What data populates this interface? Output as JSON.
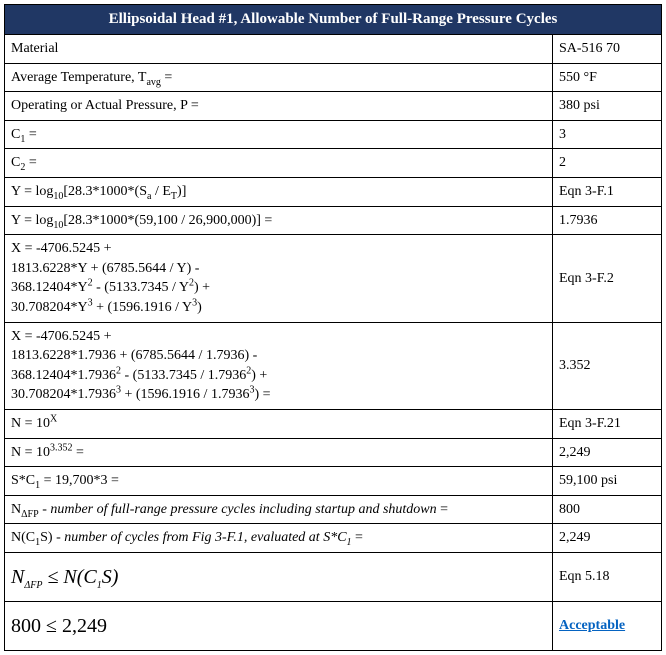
{
  "title": "Ellipsoidal Head #1, Allowable Number of Full-Range Pressure Cycles",
  "rows": {
    "material": {
      "label": "Material",
      "value": "SA-516 70"
    },
    "tavg": {
      "label_pre": "Average Temperature, T",
      "label_sub": "avg",
      "label_post": " =",
      "value": "550 °F"
    },
    "pressure": {
      "label": "Operating or Actual Pressure, P =",
      "value": "380 psi"
    },
    "c1": {
      "label_pre": "C",
      "label_sub": "1",
      "label_post": " =",
      "value": "3"
    },
    "c2": {
      "label_pre": "C",
      "label_sub": "2",
      "label_post": " =",
      "value": "2"
    },
    "ydef": {
      "label_pre": "Y = log",
      "label_sub": "10",
      "label_mid": "[28.3*1000*(S",
      "label_sub2": "a",
      "label_mid2": " / E",
      "label_sub3": "T",
      "label_post": ")]",
      "value": "Eqn 3-F.1"
    },
    "yval": {
      "label_pre": "Y = log",
      "label_sub": "10",
      "label_post": "[28.3*1000*(59,100 / 26,900,000)] =",
      "value": "1.7936"
    },
    "xdef": {
      "l1": "X = -4706.5245 +",
      "l2a": "1813.6228*Y + (6785.5644 / Y) -",
      "l3a": "368.12404*Y",
      "l3b": " - (5133.7345 / Y",
      "l3c": ") +",
      "l4a": "30.708204*Y",
      "l4b": " + (1596.1916 / Y",
      "l4c": ")",
      "value": "Eqn 3-F.2"
    },
    "xval": {
      "l1": "X = -4706.5245 +",
      "l2": "1813.6228*1.7936 + (6785.5644 / 1.7936) -",
      "l3a": "368.12404*1.7936",
      "l3b": " - (5133.7345 / 1.7936",
      "l3c": ") +",
      "l4a": "30.708204*1.7936",
      "l4b": " + (1596.1916 / 1.7936",
      "l4c": ") =",
      "value": "3.352"
    },
    "ndef": {
      "label_pre": "N = 10",
      "label_sup": "X",
      "value": "Eqn 3-F.21"
    },
    "nval": {
      "label_pre": "N = 10",
      "label_sup": "3.352",
      "label_post": " =",
      "value": "2,249"
    },
    "sc1": {
      "label_pre": "S*C",
      "label_sub": "1",
      "label_post": " = 19,700*3 =",
      "value": "59,100 psi"
    },
    "ndfp": {
      "label_pre": "N",
      "label_sub": "ΔFP",
      "label_post": " - ",
      "label_italic": "number of full-range pressure cycles including startup and shutdown",
      "label_end": " =",
      "value": "800"
    },
    "nc1s": {
      "label_pre": "N(C",
      "label_sub": "1",
      "label_post": "S) - ",
      "label_italic": "number of cycles from Fig 3-F.1, evaluated at S*C",
      "label_sub2": "1",
      "label_end": " =",
      "value": "2,249"
    },
    "ineqdef": {
      "label_l": "N",
      "label_sub1": "ΔFP",
      "label_mid": " ≤ N(C",
      "label_sub2": "1",
      "label_r": "S)",
      "value": "Eqn 5.18"
    },
    "ineqval": {
      "label": "800 ≤ 2,249",
      "value": "Acceptable"
    }
  }
}
